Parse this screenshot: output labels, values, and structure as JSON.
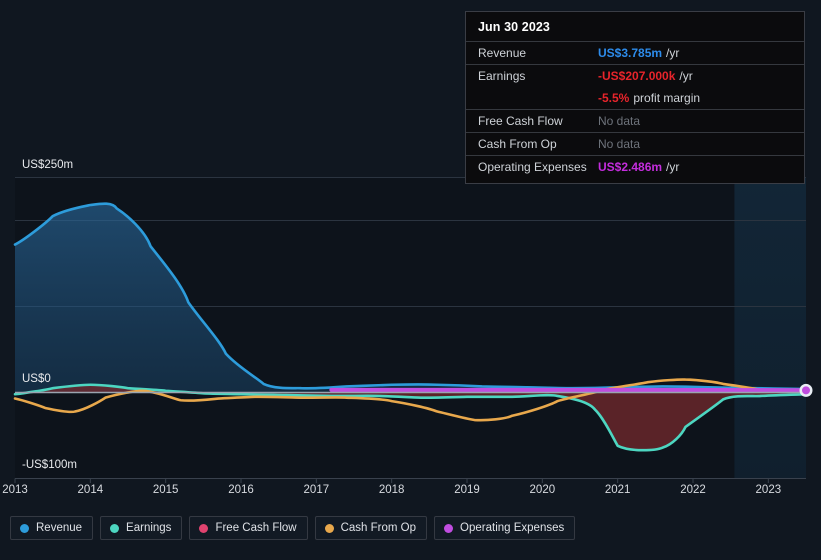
{
  "tooltip": {
    "date": "Jun 30 2023",
    "rows": [
      {
        "label": "Revenue",
        "value": "US$3.785m",
        "suffix": "/yr",
        "color": "#2d8ceb",
        "nodata": false
      },
      {
        "label": "Earnings",
        "value": "-US$207.000k",
        "suffix": "/yr",
        "color": "#e8242b",
        "nodata": false
      },
      {
        "label": "",
        "value": "-5.5%",
        "suffix": "profit margin",
        "color": "#e8242b",
        "nodata": false
      },
      {
        "label": "Free Cash Flow",
        "value": "No data",
        "suffix": "",
        "color": "#6e737b",
        "nodata": true
      },
      {
        "label": "Cash From Op",
        "value": "No data",
        "suffix": "",
        "color": "#6e737b",
        "nodata": true
      },
      {
        "label": "Operating Expenses",
        "value": "US$2.486m",
        "suffix": "/yr",
        "color": "#c42ddd",
        "nodata": false
      }
    ]
  },
  "legend": [
    {
      "label": "Revenue",
      "color": "#2d9cdb"
    },
    {
      "label": "Earnings",
      "color": "#4dd6c1"
    },
    {
      "label": "Free Cash Flow",
      "color": "#e0436f"
    },
    {
      "label": "Cash From Op",
      "color": "#e8a84c"
    },
    {
      "label": "Operating Expenses",
      "color": "#c04de0"
    }
  ],
  "chart_data": {
    "type": "area",
    "title": "",
    "xlabel": "",
    "ylabel": "",
    "ylim": [
      -100,
      250
    ],
    "xlim": [
      2013,
      2023.5
    ],
    "grid": true,
    "legend_position": "bottom",
    "y_ticks": [
      {
        "value": 250,
        "label": "US$250m"
      },
      {
        "value": 0,
        "label": "US$0"
      },
      {
        "value": -100,
        "label": "-US$100m"
      }
    ],
    "x_ticks": [
      "2013",
      "2014",
      "2015",
      "2016",
      "2017",
      "2018",
      "2019",
      "2020",
      "2021",
      "2022",
      "2023"
    ],
    "highlight_band": {
      "from": 2022.55,
      "to": 2023.5
    },
    "units": "US$ millions",
    "series": [
      {
        "name": "Revenue",
        "color": "#2d9cdb",
        "fill": "rgba(34,97,148,0.45)",
        "x": [
          2013.0,
          2013.5,
          2014.0,
          2014.35,
          2014.8,
          2015.3,
          2015.8,
          2016.3,
          2016.8,
          2017.4,
          2018.0,
          2018.6,
          2019.2,
          2019.8,
          2020.4,
          2021.0,
          2021.6,
          2022.2,
          2022.8,
          2023.5
        ],
        "values": [
          172,
          205,
          218,
          214,
          170,
          105,
          45,
          10,
          5,
          7,
          9,
          9,
          7,
          6,
          5,
          6,
          7,
          6,
          5,
          4
        ]
      },
      {
        "name": "Earnings",
        "color": "#4dd6c1",
        "fill": "rgba(120,42,46,0.72)",
        "x": [
          2013.0,
          2013.5,
          2014.0,
          2014.5,
          2015.0,
          2015.5,
          2016.0,
          2016.6,
          2017.2,
          2017.8,
          2018.4,
          2019.0,
          2019.6,
          2020.2,
          2020.7,
          2021.0,
          2021.6,
          2021.9,
          2022.4,
          2022.9,
          2023.5
        ],
        "values": [
          -2,
          5,
          9,
          5,
          2,
          -1,
          -2,
          -3,
          -4,
          -4,
          -6,
          -5,
          -5,
          -4,
          -20,
          -62,
          -64,
          -40,
          -8,
          -4,
          -2
        ]
      },
      {
        "name": "Free Cash Flow",
        "color": "#e0436f",
        "x": [],
        "values": []
      },
      {
        "name": "Cash From Op",
        "color": "#e8a84c",
        "x": [
          2013.0,
          2013.4,
          2013.8,
          2014.2,
          2014.7,
          2015.2,
          2015.7,
          2016.2,
          2016.8,
          2017.4,
          2018.0,
          2018.6,
          2019.1,
          2019.6,
          2020.2,
          2020.8,
          2021.4,
          2021.9,
          2022.4,
          2022.9,
          2023.3
        ],
        "values": [
          -7,
          -18,
          -22,
          -6,
          2,
          -9,
          -7,
          -5,
          -6,
          -6,
          -10,
          -22,
          -32,
          -27,
          -10,
          3,
          12,
          15,
          10,
          3,
          1
        ]
      },
      {
        "name": "Operating Expenses",
        "color": "#c04de0",
        "x": [
          2017.2,
          2018.0,
          2019.0,
          2020.0,
          2021.0,
          2022.0,
          2023.0,
          2023.5
        ],
        "values": [
          3.0,
          3.0,
          3.0,
          3.0,
          2.9,
          2.8,
          2.6,
          2.5
        ]
      }
    ],
    "last_point_marker": {
      "x": 2023.5,
      "y": 2.5,
      "color": "#c04de0"
    }
  }
}
